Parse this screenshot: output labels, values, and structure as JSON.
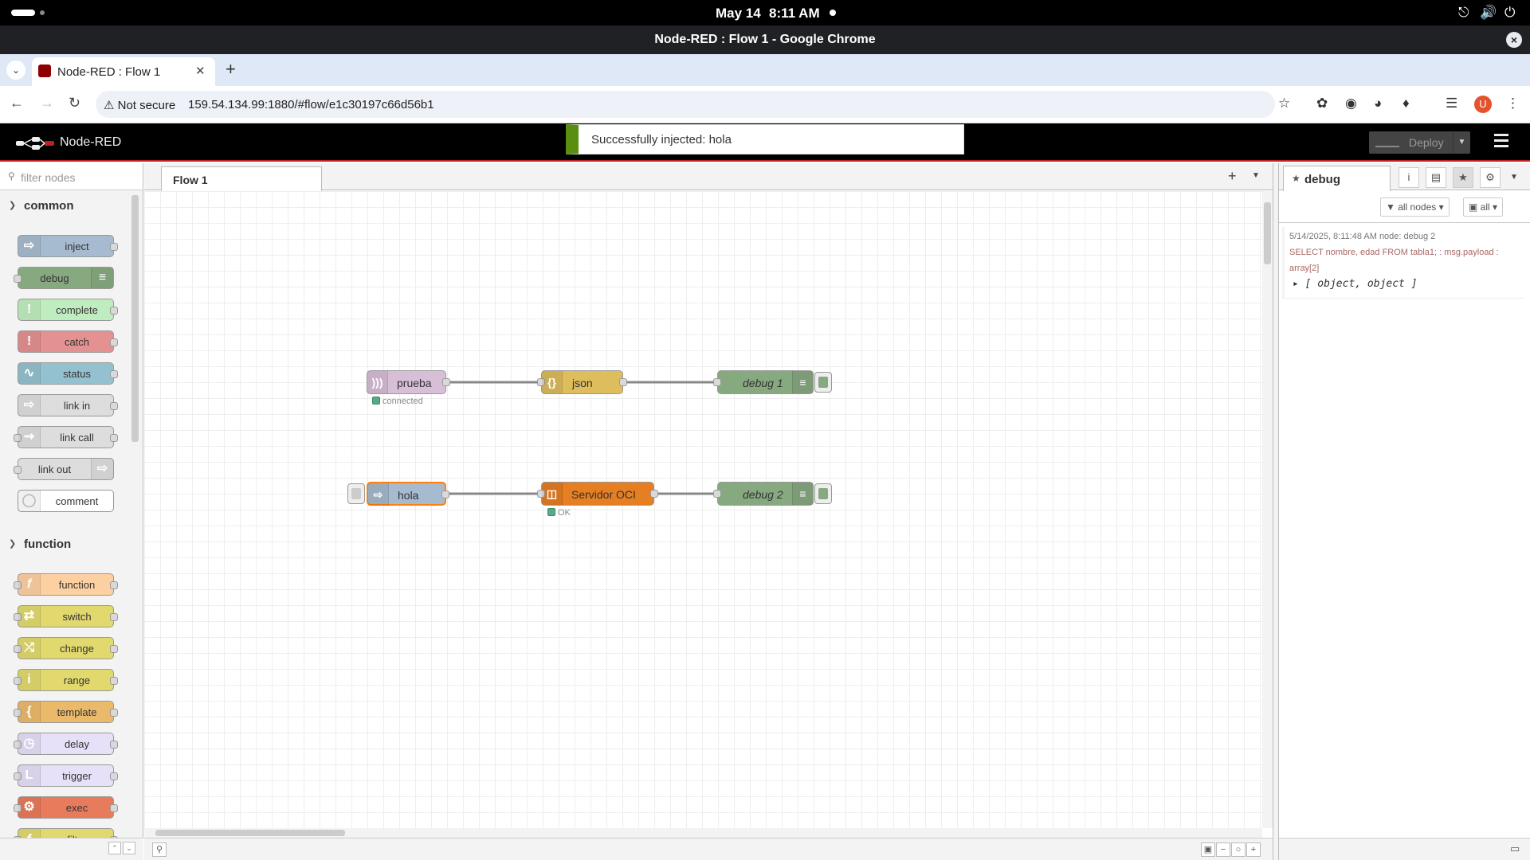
{
  "os": {
    "date": "May 14",
    "time": "8:11 AM"
  },
  "window": {
    "title": "Node-RED : Flow 1 - Google Chrome"
  },
  "browser": {
    "tab_title": "Node-RED : Flow 1",
    "security": "Not secure",
    "url": "159.54.134.99:1880/#flow/e1c30197c66d56b1",
    "avatar_letter": "U"
  },
  "nodered": {
    "app_name": "Node-RED",
    "notification": "Successfully injected: hola",
    "deploy_label": "Deploy",
    "filter_placeholder": "filter nodes",
    "categories": {
      "common": "common",
      "function": "function"
    },
    "palette_common": [
      "inject",
      "debug",
      "complete",
      "catch",
      "status",
      "link in",
      "link call",
      "link out",
      "comment"
    ],
    "palette_function": [
      "function",
      "switch",
      "change",
      "range",
      "template",
      "delay",
      "trigger",
      "exec",
      "filter"
    ],
    "flow_tab": "Flow 1",
    "flow_nodes": {
      "prueba": "prueba",
      "prueba_status": "connected",
      "json": "json",
      "debug1": "debug 1",
      "hola": "hola",
      "servidor": "Servidor OCI",
      "servidor_status": "OK",
      "debug2": "debug 2"
    },
    "sidebar": {
      "tab": "debug",
      "filter_nodes": "all nodes",
      "filter_level": "all",
      "message": {
        "meta": "5/14/2025, 8:11:48 AM    node: debug 2",
        "topic": "SELECT nombre, edad FROM tabla1; : msg.payload : array[2]",
        "value": "[ object, object ]"
      }
    }
  },
  "colors": {
    "inject": "#a6bbcf",
    "debug": "#87a980",
    "complete": "#c0edc0",
    "catch": "#e49191",
    "status": "#94c1d0",
    "link": "#dddddd",
    "function": "#fdd0a2",
    "switch": "#e2d96e",
    "change": "#e2d96e",
    "range": "#e2d96e",
    "template": "#ebb96a",
    "delay": "#e6e0f8",
    "trigger": "#e6e0f8",
    "exec": "#e87b5b",
    "mqtt": "#d8bfd8",
    "json": "#debd5c",
    "oracle": "#e67e22",
    "deploy_accent": "#5a8e10",
    "header_bar": "#c02020"
  }
}
